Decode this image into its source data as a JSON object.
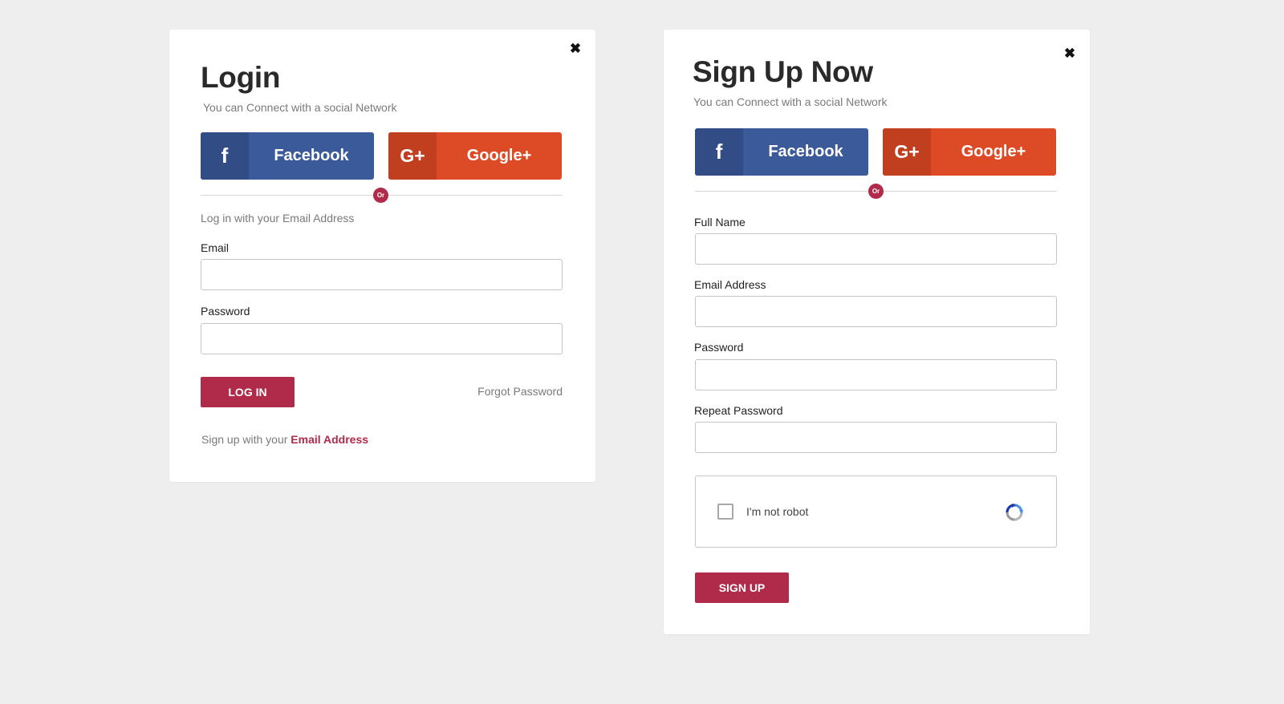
{
  "login": {
    "close_symbol": "✖",
    "title": "Login",
    "subtitle": "You can Connect with a social Network",
    "facebook": {
      "icon": "f",
      "label": "Facebook"
    },
    "google": {
      "icon": "G+",
      "label": "Google+"
    },
    "or_label": "Or",
    "hint": "Log in with your Email Address",
    "email_label": "Email",
    "email_value": "",
    "password_label": "Password",
    "password_value": "",
    "submit_label": "LOG IN",
    "forgot_label": "Forgot Password",
    "signup_prefix": "Sign up with your ",
    "signup_link": "Email Address"
  },
  "signup": {
    "close_symbol": "✖",
    "title": "Sign Up Now",
    "subtitle": "You can Connect with a social Network",
    "facebook": {
      "icon": "f",
      "label": "Facebook"
    },
    "google": {
      "icon": "G+",
      "label": "Google+"
    },
    "or_label": "Or",
    "fullname_label": "Full Name",
    "fullname_value": "",
    "email_label": "Email Address",
    "email_value": "",
    "password_label": "Password",
    "password_value": "",
    "repeat_label": "Repeat Password",
    "repeat_value": "",
    "captcha_label": "I'm not robot",
    "captcha_checked": false,
    "submit_label": "SIGN UP"
  },
  "icons": {
    "close": "close-icon",
    "facebook": "facebook-icon",
    "google": "google-plus-icon",
    "captcha": "recaptcha-icon"
  },
  "colors": {
    "background": "#eeeeee",
    "card": "#ffffff",
    "accent": "#b02a4a",
    "facebook": "#3b5a9a",
    "facebook_dark": "#324d85",
    "google": "#dd4b26",
    "google_dark": "#c13f1f",
    "muted_text": "#7a7a7a"
  }
}
